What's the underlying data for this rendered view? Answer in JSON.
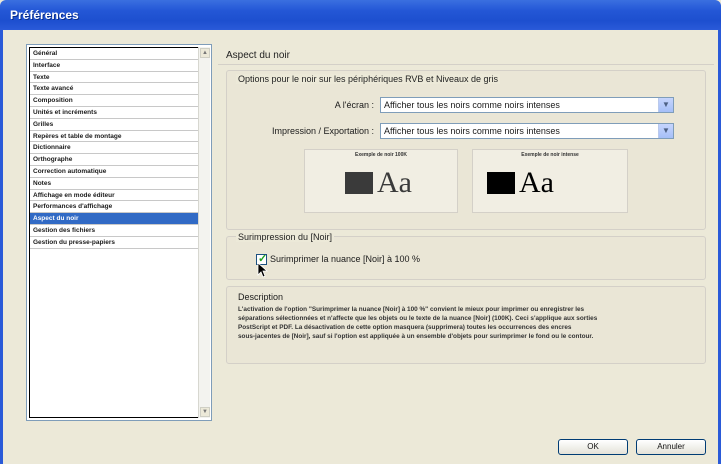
{
  "window": {
    "title": "Préférences"
  },
  "sidebar": {
    "items": [
      {
        "label": "Général",
        "selected": false
      },
      {
        "label": "Interface",
        "selected": false
      },
      {
        "label": "Texte",
        "selected": false
      },
      {
        "label": "Texte avancé",
        "selected": false
      },
      {
        "label": "Composition",
        "selected": false
      },
      {
        "label": "Unités et incréments",
        "selected": false
      },
      {
        "label": "Grilles",
        "selected": false
      },
      {
        "label": "Repères et table de montage",
        "selected": false
      },
      {
        "label": "Dictionnaire",
        "selected": false
      },
      {
        "label": "Orthographe",
        "selected": false
      },
      {
        "label": "Correction automatique",
        "selected": false
      },
      {
        "label": "Notes",
        "selected": false
      },
      {
        "label": "Affichage en mode éditeur",
        "selected": false
      },
      {
        "label": "Performances d'affichage",
        "selected": false
      },
      {
        "label": "Aspect du noir",
        "selected": true
      },
      {
        "label": "Gestion des fichiers",
        "selected": false
      },
      {
        "label": "Gestion du presse-papiers",
        "selected": false
      }
    ]
  },
  "panel": {
    "title": "Aspect du noir",
    "options_group": {
      "title": "Options pour le noir sur les périphériques RVB et Niveaux de gris",
      "screen_label": "A l'écran :",
      "screen_value": "Afficher tous les noirs comme noirs intenses",
      "print_label": "Impression / Exportation :",
      "print_value": "Afficher tous les noirs comme noirs intenses",
      "sample_100k_label": "Exemple de noir 100K",
      "sample_rich_label": "Exemple de noir intense",
      "sample_text": "Aa"
    },
    "overprint_group": {
      "title": "Surimpression du [Noir]",
      "checkbox_label": "Surimprimer la nuance [Noir] à 100 %",
      "checked": true
    },
    "description": {
      "title": "Description",
      "lines": [
        "L'activation de l'option \"Surimprimer la nuance [Noir] à 100 %\" convient le mieux pour imprimer ou enregistrer les",
        "séparations sélectionnées et n'affecte que les objets ou le texte de la nuance [Noir] (100K). Ceci s'applique aux sorties",
        "PostScript et PDF. La désactivation de cette option masquera (supprimera) toutes les occurrences des encres",
        "sous-jacentes de [Noir], sauf si l'option est appliquée à un ensemble d'objets pour surimprimer le fond ou le contour."
      ]
    }
  },
  "buttons": {
    "ok": "OK",
    "cancel": "Annuler"
  },
  "colors": {
    "selection": "#316ac5",
    "black_100k": "#3a3a3a",
    "black_rich": "#000000"
  }
}
